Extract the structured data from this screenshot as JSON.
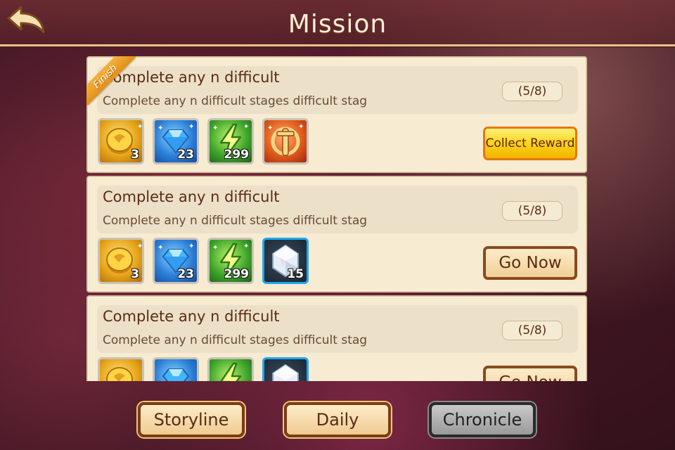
{
  "header": {
    "title": "Mission",
    "back_icon": "back-arrow-icon"
  },
  "missions": [
    {
      "title": "Complete any n difficult",
      "description": "Complete any n difficult stages  difficult stag",
      "progress": "(5/8)",
      "badge": "Finish",
      "action_label": "Collect Reward",
      "rewards": [
        {
          "icon": "gold-coin-icon",
          "qty": "3"
        },
        {
          "icon": "diamond-icon",
          "qty": "23"
        },
        {
          "icon": "energy-icon",
          "qty": "299"
        },
        {
          "icon": "helmet-icon",
          "qty": ""
        }
      ]
    },
    {
      "title": "Complete any n difficult",
      "description": "Complete any n difficult stages  difficult stag",
      "progress": "(5/8)",
      "action_label": "Go Now",
      "rewards": [
        {
          "icon": "gold-coin-icon",
          "qty": "3"
        },
        {
          "icon": "diamond-icon",
          "qty": "23"
        },
        {
          "icon": "energy-icon",
          "qty": "299"
        },
        {
          "icon": "crystal-icon",
          "qty": "15"
        }
      ]
    },
    {
      "title": "Complete any n difficult",
      "description": "Complete any n difficult stages  difficult stag",
      "progress": "(5/8)",
      "action_label": "Go Now",
      "rewards": [
        {
          "icon": "gold-coin-icon",
          "qty": ""
        },
        {
          "icon": "diamond-icon",
          "qty": ""
        },
        {
          "icon": "energy-icon",
          "qty": ""
        },
        {
          "icon": "crystal-icon",
          "qty": ""
        }
      ]
    }
  ],
  "tabs": [
    {
      "label": "Storyline",
      "state": "normal"
    },
    {
      "label": "Daily",
      "state": "normal"
    },
    {
      "label": "Chronicle",
      "state": "selected"
    }
  ],
  "colors": {
    "accent_gold": "#ffd21a",
    "button_border": "#8a4a1e",
    "card_bg": "#f7ebd2",
    "selected_tab": "#9a9a9a"
  }
}
